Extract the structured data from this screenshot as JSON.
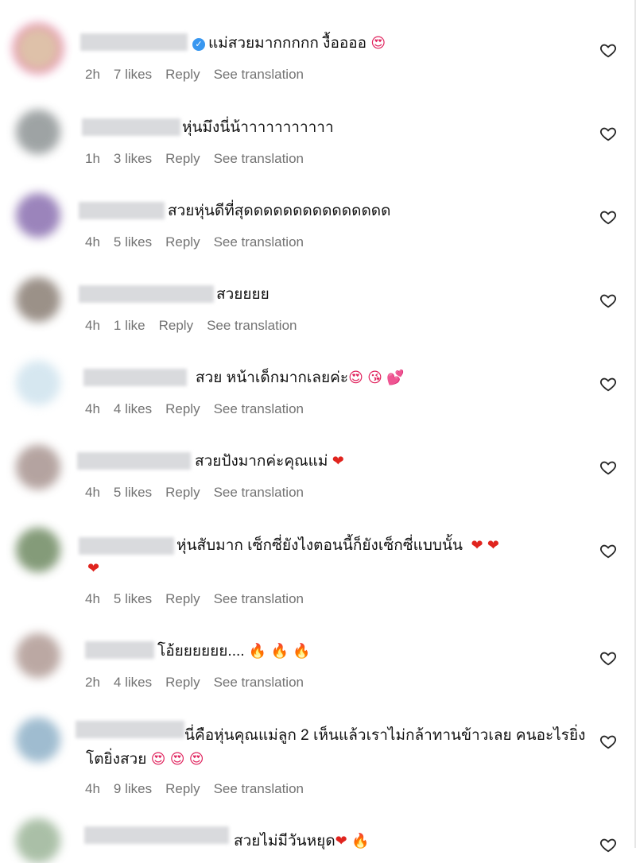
{
  "comments": [
    {
      "text": "แม่สวยมากกกกก งื้ออออ",
      "emojis": [
        "😍"
      ],
      "verified": true,
      "time": "2h",
      "likes": "7 likes",
      "reply": "Reply",
      "translate": "See translation"
    },
    {
      "text": "หุ่นมึงนี่น้าาาาาาาาาาา",
      "emojis": [],
      "time": "1h",
      "likes": "3 likes",
      "reply": "Reply",
      "translate": "See translation"
    },
    {
      "text": "สวยหุ่นดีที่สุดดดดดดดดดดดดดดด",
      "emojis": [],
      "time": "4h",
      "likes": "5 likes",
      "reply": "Reply",
      "translate": "See translation"
    },
    {
      "text": "สวยยยย",
      "emojis": [],
      "time": "4h",
      "likes": "1 like",
      "reply": "Reply",
      "translate": "See translation"
    },
    {
      "text": "สวย หน้าเด็กมากเลยค่ะ",
      "emojis": [
        "😍",
        "😘",
        "💕"
      ],
      "time": "4h",
      "likes": "4 likes",
      "reply": "Reply",
      "translate": "See translation"
    },
    {
      "text": "สวยปังมากค่ะคุณแม่",
      "emojis": [
        "❤"
      ],
      "time": "4h",
      "likes": "5 likes",
      "reply": "Reply",
      "translate": "See translation"
    },
    {
      "text": "หุ่นสับมาก เซ็กซี่ยังไงตอนนี้ก็ยังเซ็กซี่แบบนั้น",
      "emojis": [
        "❤",
        "❤",
        "❤"
      ],
      "time": "4h",
      "likes": "5 likes",
      "reply": "Reply",
      "translate": "See translation"
    },
    {
      "text": "โอ้ยยยยยย....",
      "emojis": [
        "🔥",
        "🔥",
        "🔥"
      ],
      "time": "2h",
      "likes": "4 likes",
      "reply": "Reply",
      "translate": "See translation"
    },
    {
      "text": "นี่คือหุ่นคุณแม่ลูก 2 เห็นแล้วเราไม่กล้าทานข้าวเลย คนอะไรยิ่งโตยิ่งสวย",
      "emojis": [
        "😍",
        "😍",
        "😍"
      ],
      "time": "4h",
      "likes": "9 likes",
      "reply": "Reply",
      "translate": "See translation"
    },
    {
      "text": "สวยไม่มีวันหยุด",
      "emojis": [
        "❤",
        "🔥"
      ]
    }
  ],
  "icons": {
    "like": "heart-outline-icon",
    "verified": "verified-badge-icon"
  },
  "colors": {
    "meta_text": "#737373",
    "verified": "#3897f0",
    "story_ring": "#d62976"
  }
}
